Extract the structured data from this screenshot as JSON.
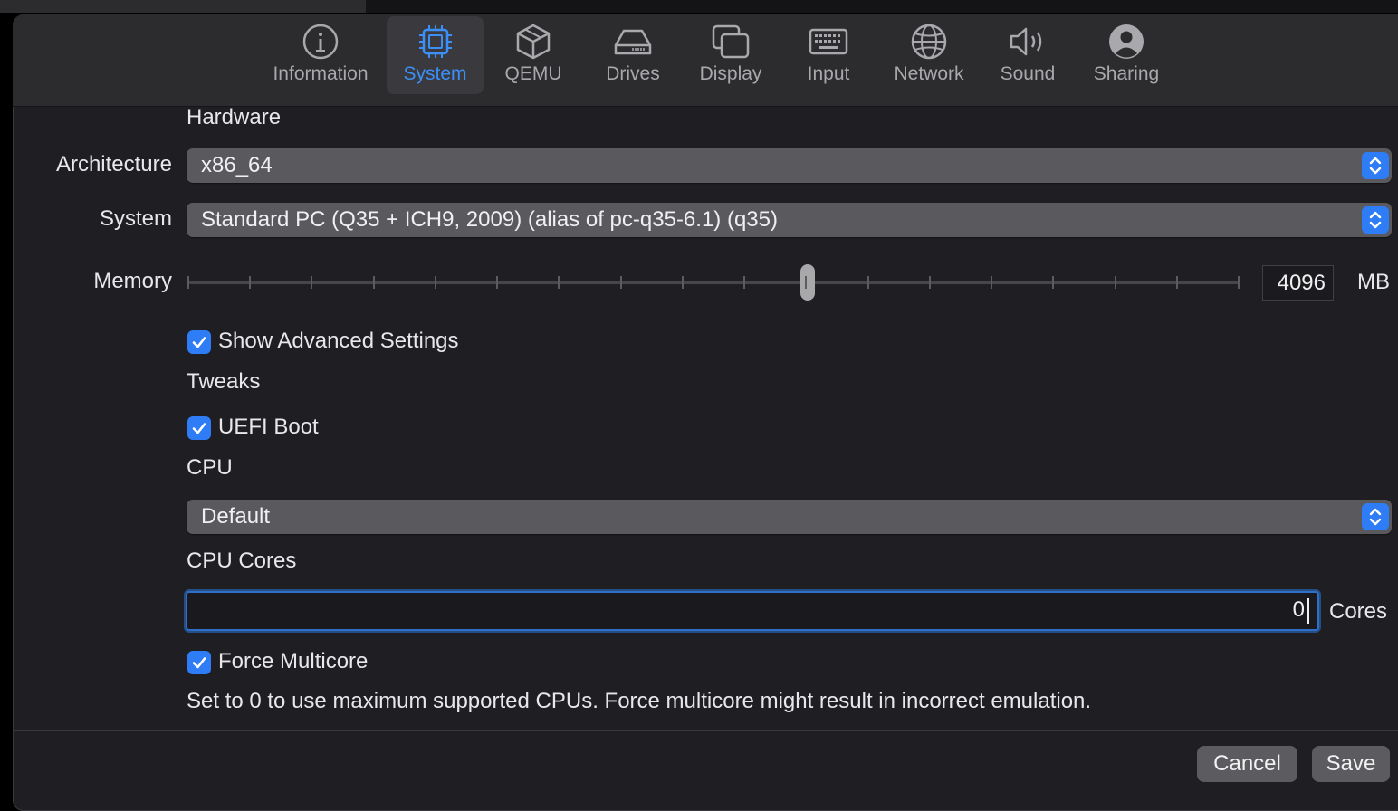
{
  "tabs": [
    {
      "label": "Information",
      "icon": "info-icon"
    },
    {
      "label": "System",
      "icon": "chip-icon",
      "active": true
    },
    {
      "label": "QEMU",
      "icon": "cube-icon"
    },
    {
      "label": "Drives",
      "icon": "drive-icon"
    },
    {
      "label": "Display",
      "icon": "display-icon"
    },
    {
      "label": "Input",
      "icon": "keyboard-icon"
    },
    {
      "label": "Network",
      "icon": "globe-icon"
    },
    {
      "label": "Sound",
      "icon": "speaker-icon"
    },
    {
      "label": "Sharing",
      "icon": "person-icon"
    }
  ],
  "hardware": {
    "section_title": "Hardware",
    "architecture_label": "Architecture",
    "architecture_value": "x86_64",
    "system_label": "System",
    "system_value": "Standard PC (Q35 + ICH9, 2009) (alias of pc-q35-6.1) (q35)",
    "memory_label": "Memory",
    "memory_value": "4096",
    "memory_unit": "MB",
    "memory_slider_fraction": 0.59
  },
  "advanced": {
    "show_advanced_label": "Show Advanced Settings",
    "show_advanced_checked": true
  },
  "tweaks": {
    "section_title": "Tweaks",
    "uefi_label": "UEFI Boot",
    "uefi_checked": true
  },
  "cpu": {
    "section_title": "CPU",
    "cpu_value": "Default",
    "cores_title": "CPU Cores",
    "cores_value": "0",
    "cores_unit": "Cores",
    "force_multicore_label": "Force Multicore",
    "force_multicore_checked": true,
    "hint": "Set to 0 to use maximum supported CPUs. Force multicore might result in incorrect emulation."
  },
  "footer": {
    "cancel_label": "Cancel",
    "save_label": "Save"
  },
  "colors": {
    "accent": "#2f7df6",
    "window_bg": "#1f1e23",
    "toolbar_bg": "#2c2c2f"
  }
}
